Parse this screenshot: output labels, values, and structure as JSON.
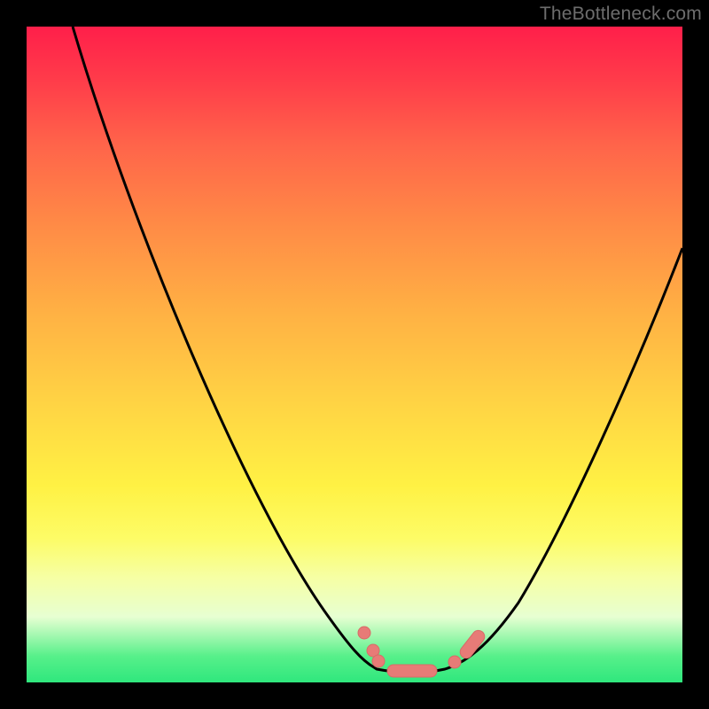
{
  "watermark": "TheBottleneck.com",
  "colors": {
    "background": "#000000",
    "curve_stroke": "#000000",
    "marker_fill": "#e77b77",
    "marker_stroke": "#d86b67"
  },
  "chart_data": {
    "type": "line",
    "title": "",
    "xlabel": "",
    "ylabel": "",
    "xlim": [
      0,
      100
    ],
    "ylim": [
      0,
      100
    ],
    "note": "No numeric axis ticks are rendered in the image; coordinates below are read off the plot canvas as percentages (0–100) with 0 at left/bottom.",
    "series": [
      {
        "name": "left-branch",
        "x": [
          7,
          10,
          14,
          18,
          22,
          26,
          30,
          34,
          38,
          42,
          45,
          47.5,
          49.5,
          51,
          52,
          53
        ],
        "y": [
          100,
          93,
          84,
          75,
          66,
          57,
          48,
          40,
          32,
          24,
          17,
          12,
          8,
          5,
          3,
          2
        ]
      },
      {
        "name": "valley-floor",
        "x": [
          53,
          56,
          59,
          62,
          64
        ],
        "y": [
          2,
          1.5,
          1.5,
          1.8,
          2.2
        ]
      },
      {
        "name": "right-branch",
        "x": [
          64,
          67,
          70,
          74,
          78,
          82,
          86,
          90,
          94,
          98,
          100
        ],
        "y": [
          2.2,
          4,
          7,
          12,
          19,
          27,
          35,
          44,
          53,
          62,
          67
        ]
      }
    ],
    "markers": [
      {
        "name": "left-dot-1",
        "x": 51.5,
        "y": 7.5
      },
      {
        "name": "left-dot-2",
        "x": 52.8,
        "y": 4.8
      },
      {
        "name": "left-dot-3",
        "x": 53.6,
        "y": 3.2
      },
      {
        "name": "valley-bar",
        "shape": "pill",
        "x0": 55,
        "x1": 62.5,
        "y": 1.6
      },
      {
        "name": "right-dot-1",
        "x": 65.2,
        "y": 3.0
      },
      {
        "name": "right-bar",
        "shape": "pill-diagonal",
        "x0": 66.5,
        "y0": 4.2,
        "x1": 69.5,
        "y1": 8.0
      }
    ]
  }
}
